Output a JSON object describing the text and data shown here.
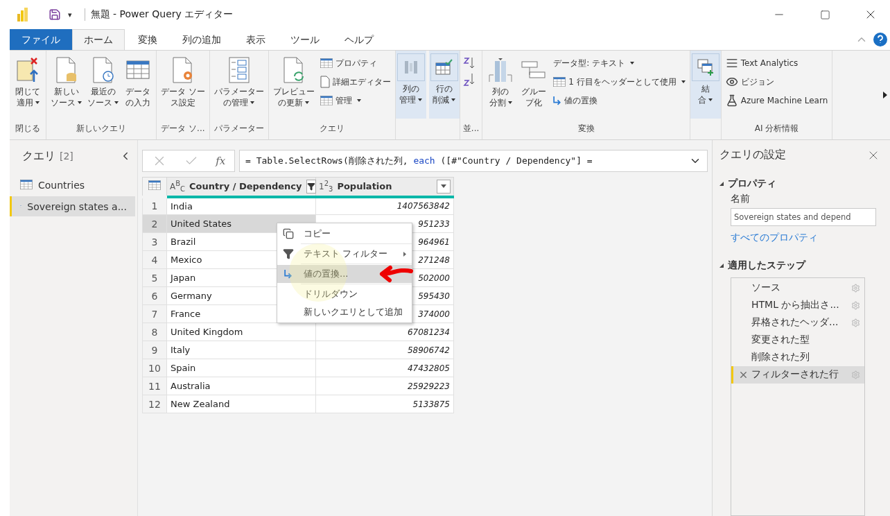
{
  "window": {
    "title": "無題 - Power Query エディター",
    "customize_glyph": "▾"
  },
  "tabs": [
    {
      "label": "ファイル",
      "kind": "file",
      "selected": false
    },
    {
      "label": "ホーム",
      "kind": "tab",
      "selected": true
    },
    {
      "label": "変換",
      "kind": "tab",
      "selected": false
    },
    {
      "label": "列の追加",
      "kind": "tab",
      "selected": false
    },
    {
      "label": "表示",
      "kind": "tab",
      "selected": false
    },
    {
      "label": "ツール",
      "kind": "tab",
      "selected": false
    },
    {
      "label": "ヘルプ",
      "kind": "tab",
      "selected": false
    }
  ],
  "ribbon": [
    {
      "label": "閉じる",
      "kind": "buttons",
      "items": [
        {
          "kind": "large",
          "lines": [
            "閉じて",
            "適用"
          ],
          "menu": true,
          "highlighted": false
        }
      ]
    },
    {
      "label": "新しいクエリ",
      "kind": "buttons",
      "items": [
        {
          "kind": "large",
          "lines": [
            "新しい",
            "ソース"
          ],
          "menu": true,
          "highlighted": false
        },
        {
          "kind": "large",
          "lines": [
            "最近の",
            "ソース"
          ],
          "menu": true,
          "highlighted": false
        },
        {
          "kind": "large",
          "lines": [
            "データ",
            "の入力"
          ],
          "menu": false,
          "highlighted": false
        }
      ]
    },
    {
      "label": "データ ソ...",
      "kind": "buttons",
      "items": [
        {
          "kind": "large",
          "lines": [
            "データ ソー",
            "ス設定"
          ],
          "menu": false,
          "highlighted": false
        }
      ]
    },
    {
      "label": "パラメーター",
      "kind": "buttons",
      "items": [
        {
          "kind": "large",
          "lines": [
            "パラメーター",
            "の管理"
          ],
          "menu": true,
          "highlighted": false
        }
      ]
    },
    {
      "label": "クエリ",
      "kind": "buttons",
      "items": [
        {
          "kind": "large",
          "lines": [
            "プレビュー",
            "の更新"
          ],
          "menu": true,
          "highlighted": false
        },
        {
          "kind": "small",
          "label": "プロパティ",
          "menu": false
        },
        {
          "kind": "small",
          "label": "詳細エディター",
          "menu": false
        },
        {
          "kind": "small",
          "label": "管理",
          "menu": true
        }
      ]
    },
    {
      "kind": "buttons",
      "items": [
        {
          "kind": "large",
          "lines": [
            "列の",
            "管理"
          ],
          "menu": true,
          "highlighted": true
        },
        {
          "kind": "large",
          "lines": [
            "行の",
            "削減"
          ],
          "menu": true,
          "highlighted": true
        }
      ]
    },
    {
      "label": "並...",
      "kind": "sort"
    },
    {
      "label": "変換",
      "kind": "buttons",
      "items": [
        {
          "kind": "large",
          "lines": [
            "列の",
            "分割"
          ],
          "menu": true,
          "highlighted": false
        },
        {
          "kind": "large",
          "lines": [
            "グルー",
            "プ化"
          ],
          "menu": false,
          "highlighted": false
        },
        {
          "kind": "small",
          "label": "データ型: テキスト",
          "menu": true
        },
        {
          "kind": "small",
          "label": "1 行目をヘッダーとして使用",
          "menu": true
        },
        {
          "kind": "small",
          "label": "値の置換",
          "menu": false
        }
      ]
    },
    {
      "kind": "buttons",
      "items": [
        {
          "kind": "large",
          "lines": [
            "結",
            "合"
          ],
          "menu": true,
          "highlighted": true
        }
      ]
    },
    {
      "label": "AI 分析情報",
      "kind": "buttons",
      "items": [
        {
          "kind": "small",
          "label": "Text Analytics",
          "menu": false
        },
        {
          "kind": "small",
          "label": "ビジョン",
          "menu": false
        },
        {
          "kind": "small",
          "label": "Azure Machine Learn",
          "menu": false
        }
      ]
    }
  ],
  "queries_pane": {
    "title": "クエリ",
    "count": "[2]",
    "items": [
      {
        "label": "Countries",
        "selected": false
      },
      {
        "label": "Sovereign states a...",
        "selected": true
      }
    ]
  },
  "formula_bar": {
    "fx": "fx",
    "segments": [
      {
        "kind": "plain",
        "text": "= Table.SelectRows(削除された列, "
      },
      {
        "kind": "keyword",
        "text": "each"
      },
      {
        "kind": "plain",
        "text": " ([#\"Country / Dependency\"] ="
      }
    ]
  },
  "table": {
    "columns": [
      {
        "type_label": "A$^{B}$$_{C}$",
        "name": "Country / Dependency",
        "filtered": true
      },
      {
        "type_label": "1$^{2}$$_{3}$",
        "name": "Population",
        "filtered": false
      }
    ],
    "rows": [
      {
        "number": "1",
        "country": "India",
        "population": "1407563842",
        "selected": false
      },
      {
        "number": "2",
        "country": "United States",
        "population": "951233",
        "selected": true
      },
      {
        "number": "3",
        "country": "Brazil",
        "population": "964961",
        "selected": false
      },
      {
        "number": "4",
        "country": "Mexico",
        "population": "271248",
        "selected": false
      },
      {
        "number": "5",
        "country": "Japan",
        "population": "502000",
        "selected": false
      },
      {
        "number": "6",
        "country": "Germany",
        "population": "595430",
        "selected": false
      },
      {
        "number": "7",
        "country": "France",
        "population": "374000",
        "selected": false
      },
      {
        "number": "8",
        "country": "United Kingdom",
        "population": "67081234",
        "selected": false
      },
      {
        "number": "9",
        "country": "Italy",
        "population": "58906742",
        "selected": false
      },
      {
        "number": "10",
        "country": "Spain",
        "population": "47432805",
        "selected": false
      },
      {
        "number": "11",
        "country": "Australia",
        "population": "25929223",
        "selected": false
      },
      {
        "number": "12",
        "country": "New Zealand",
        "population": "5133875",
        "selected": false
      }
    ]
  },
  "context_menu": [
    {
      "label": "コピー",
      "submenu": false,
      "selected": false
    },
    {
      "label": "テキスト フィルター",
      "submenu": true,
      "selected": false
    },
    {
      "label": "値の置換...",
      "submenu": false,
      "selected": true
    },
    {
      "label": "ドリルダウン",
      "submenu": false,
      "selected": false
    },
    {
      "label": "新しいクエリとして追加",
      "submenu": false,
      "selected": false
    }
  ],
  "settings_pane": {
    "title": "クエリの設定",
    "properties_heading": "プロパティ",
    "name_label": "名前",
    "name_value": "Sovereign states and depend",
    "all_properties_link": "すべてのプロパティ",
    "steps_heading": "適用したステップ",
    "steps": [
      {
        "label": "ソース",
        "settings": true,
        "selected": false
      },
      {
        "label": "HTML から抽出さ...",
        "settings": true,
        "selected": false
      },
      {
        "label": "昇格されたヘッダ...",
        "settings": true,
        "selected": false
      },
      {
        "label": "変更された型",
        "settings": false,
        "selected": false
      },
      {
        "label": "削除された列",
        "settings": false,
        "selected": false
      },
      {
        "label": "フィルターされた行",
        "settings": true,
        "selected": true
      }
    ]
  }
}
